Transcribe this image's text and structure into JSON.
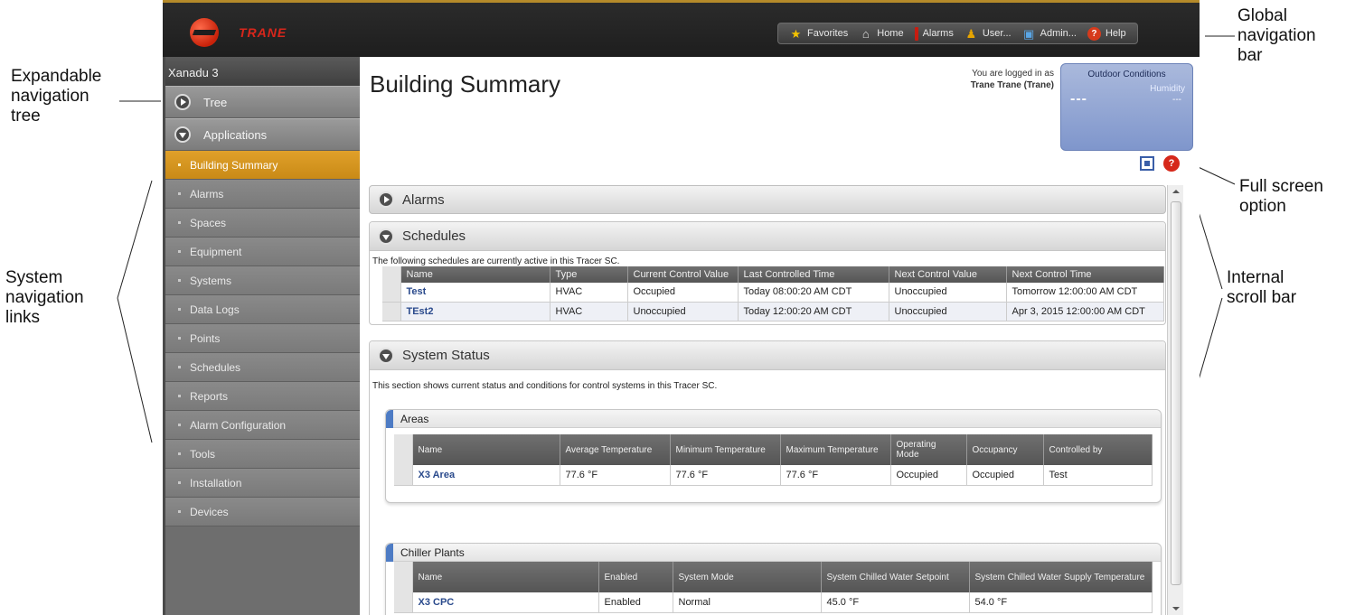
{
  "callouts": {
    "global_nav": "Global\nnavigation\nbar",
    "expandable_tree": "Expandable\nnavigation\ntree",
    "system_nav": "System\nnavigation\nlinks",
    "full_screen": "Full screen\noption",
    "internal_scroll": "Internal\nscroll bar"
  },
  "logo": {
    "text": "TRANE"
  },
  "global_nav": [
    {
      "label": "Favorites",
      "icon": "star-icon"
    },
    {
      "label": "Home",
      "icon": "home-icon"
    },
    {
      "label": "Alarms",
      "icon": "alarm-icon"
    },
    {
      "label": "User...",
      "icon": "user-icon"
    },
    {
      "label": "Admin...",
      "icon": "admin-icon"
    },
    {
      "label": "Help",
      "icon": "help-icon"
    }
  ],
  "sidebar": {
    "site_name": "Xanadu 3",
    "tree_label": "Tree",
    "applications_label": "Applications",
    "items": [
      "Building Summary",
      "Alarms",
      "Spaces",
      "Equipment",
      "Systems",
      "Data Logs",
      "Points",
      "Schedules",
      "Reports",
      "Alarm Configuration",
      "Tools",
      "Installation",
      "Devices"
    ],
    "active_index": 0
  },
  "header": {
    "title": "Building Summary",
    "logged_in_line": "You are logged in as",
    "logged_in_user": "Trane Trane (Trane)"
  },
  "outdoor": {
    "title": "Outdoor Conditions",
    "humidity_label": "Humidity",
    "temp_value": "---",
    "humidity_value": "---"
  },
  "alarms_panel": {
    "title": "Alarms"
  },
  "schedules_panel": {
    "title": "Schedules",
    "note": "The following schedules are currently active in this Tracer SC.",
    "columns": [
      "Name",
      "Type",
      "Current Control Value",
      "Last Controlled Time",
      "Next Control Value",
      "Next Control Time"
    ],
    "rows": [
      [
        "Test",
        "HVAC",
        "Occupied",
        "Today 08:00:20 AM CDT",
        "Unoccupied",
        "Tomorrow 12:00:00 AM CDT"
      ],
      [
        "TEst2",
        "HVAC",
        "Unoccupied",
        "Today 12:00:20 AM CDT",
        "Unoccupied",
        "Apr 3, 2015 12:00:00 AM CDT"
      ]
    ]
  },
  "system_status_panel": {
    "title": "System Status",
    "note": "This section shows current status and conditions for control systems in this Tracer SC.",
    "areas": {
      "title": "Areas",
      "columns": [
        "Name",
        "Average Temperature",
        "Minimum Temperature",
        "Maximum Temperature",
        "Operating Mode",
        "Occupancy",
        "Controlled by"
      ],
      "rows": [
        [
          "X3 Area",
          "77.6 °F",
          "77.6 °F",
          "77.6 °F",
          "Occupied",
          "Occupied",
          "Test"
        ]
      ]
    },
    "chiller_plants": {
      "title": "Chiller Plants",
      "columns": [
        "Name",
        "Enabled",
        "System Mode",
        "System Chilled Water Setpoint",
        "System Chilled Water Supply Temperature"
      ],
      "rows": [
        [
          "X3 CPC",
          "Enabled",
          "Normal",
          "45.0 °F",
          "54.0 °F"
        ]
      ]
    }
  }
}
